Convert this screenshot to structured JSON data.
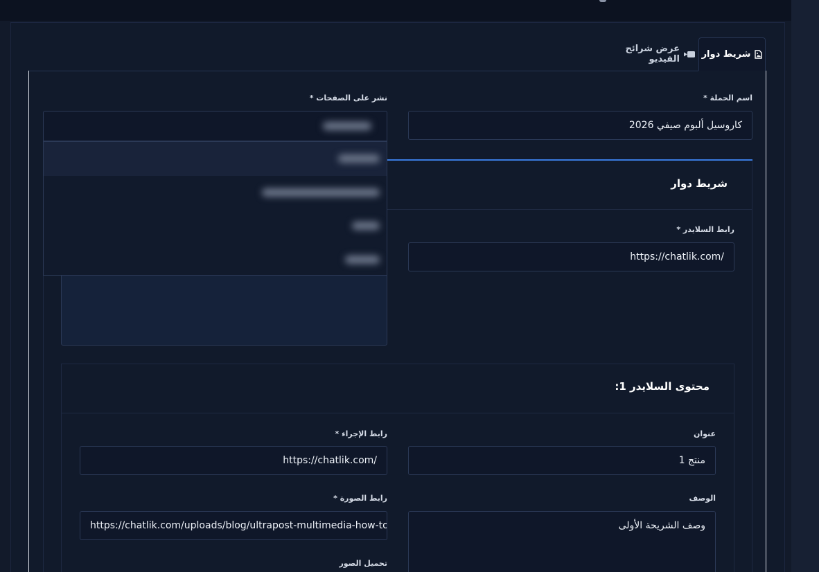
{
  "tabs": [
    {
      "label": "شريط دوار",
      "icon": "file-image-icon",
      "active": true
    },
    {
      "label": "عرض شرائح الفيديو",
      "icon": "video-camera-icon",
      "active": false
    }
  ],
  "form": {
    "campaign_name_label": "اسم الحملة *",
    "campaign_name_value": "كاروسيل ألبوم صيفي 2026",
    "publish_pages_label": "نشر على الصفحات *",
    "publish_pages_dropdown_open": true
  },
  "carousel": {
    "heading": "شريط دوار",
    "slider_url_label": "رابط السلايدر *",
    "slider_url_value": "https://chatlik.com/"
  },
  "slide1": {
    "heading": "محتوى السلايدر 1:",
    "title_label": "عنوان",
    "title_value": "منتج 1",
    "action_url_label": "رابط الإجراء *",
    "action_url_value": "https://chatlik.com/",
    "description_label": "الوصف",
    "description_value": "وصف الشريحة الأولى",
    "image_url_label": "رابط الصورة *",
    "image_url_value": "https://chatlik.com/uploads/blog/ultrapost-multimedia-how-to.jpg",
    "upload_images_label": "تحميل الصور"
  },
  "colors": {
    "accent": "#3a7be0",
    "background": "#121a2a",
    "input_bg": "#0f1729"
  }
}
